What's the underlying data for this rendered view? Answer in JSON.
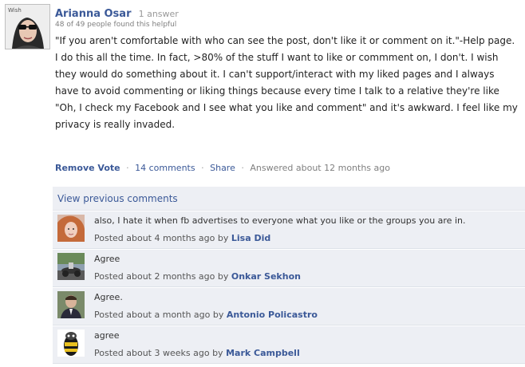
{
  "answer": {
    "author": "Arianna Osar",
    "answer_count": "1 answer",
    "helpful": "48 of 49 people found this helpful",
    "body_lines": [
      "\"If you aren't comfortable with who can see the post, don't like it or comment on it.\"-Help page.",
      "I do this all the time. In fact, >80% of the stuff I want to like or commment on, I don't. I wish they would do something about it. I can't support/interact with my liked pages and I always have to avoid commenting or liking things because every time I talk to a relative they're like \"Oh, I check my Facebook and I see what you like and comment\" and it's awkward. I feel like my privacy is really invaded."
    ],
    "avatar_badge": "Wish",
    "actions": {
      "remove_vote": "Remove Vote",
      "comments": "14 comments",
      "share": "Share",
      "answered": "Answered about 12 months ago",
      "separator": "·"
    }
  },
  "comments_section": {
    "view_previous": "View previous comments",
    "posted_by_prefix": "by",
    "items": [
      {
        "text": "also, I hate it when fb advertises to everyone what you like or the groups you are in.",
        "posted": "Posted about 4 months ago",
        "author": "Lisa Did"
      },
      {
        "text": "Agree",
        "posted": "Posted about 2 months ago",
        "author": "Onkar Sekhon"
      },
      {
        "text": "Agree.",
        "posted": "Posted about a month ago",
        "author": "Antonio Policastro"
      },
      {
        "text": "agree",
        "posted": "Posted about 3 weeks ago",
        "author": "Mark Campbell"
      }
    ]
  },
  "colors": {
    "link": "#3b5998",
    "comment_bg": "#edeff4",
    "muted": "#808080"
  }
}
